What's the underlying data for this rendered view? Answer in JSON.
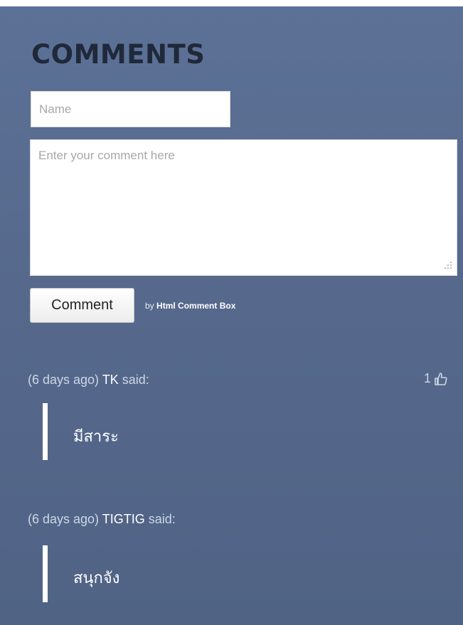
{
  "header": {
    "title": "COMMENTS"
  },
  "form": {
    "name_placeholder": "Name",
    "comment_placeholder": "Enter your comment here",
    "submit_label": "Comment",
    "byline_prefix": "by",
    "byline_brand": "Html Comment Box"
  },
  "comments": [
    {
      "time": "(6 days ago)",
      "author": "TK",
      "said": "said:",
      "likes": "1",
      "like_icon": "thumbs-up-icon",
      "text": "มีสาระ"
    },
    {
      "time": "(6 days ago)",
      "author": "TIGTIG",
      "said": "said:",
      "text": "สนุกจัง"
    }
  ],
  "colors": {
    "panel": "#56698d",
    "title": "#20293a",
    "quote_bar": "#ffffff"
  }
}
